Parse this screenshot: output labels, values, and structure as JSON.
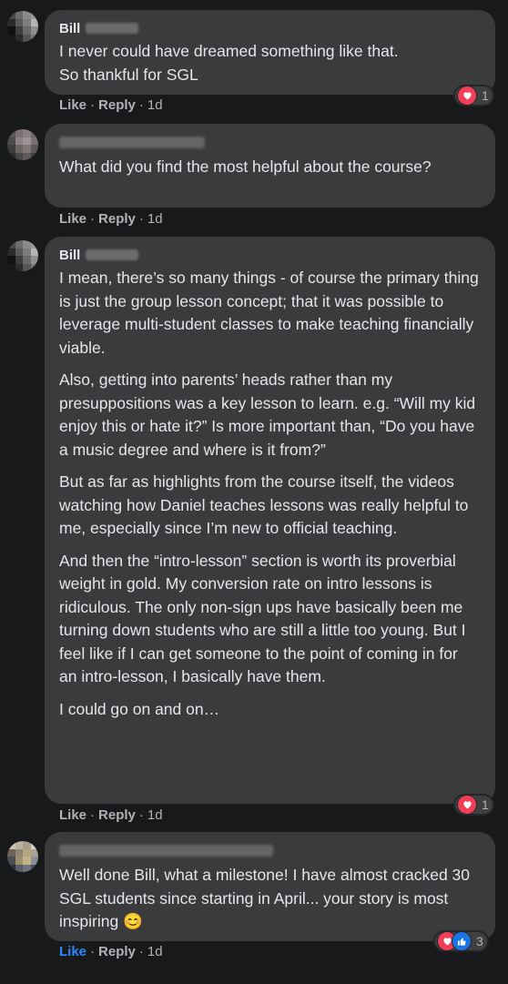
{
  "comments": [
    {
      "author_first": "Bill",
      "paragraphs": [
        "I never could have dreamed something like that.\nSo thankful for SGL"
      ],
      "actions": {
        "like": "Like",
        "reply": "Reply",
        "time": "1d"
      },
      "reactions": {
        "count": "1",
        "types": [
          "love-icon"
        ]
      }
    },
    {
      "author_first": "",
      "paragraphs": [
        "What did you find the most helpful about the course?"
      ],
      "actions": {
        "like": "Like",
        "reply": "Reply",
        "time": "1d"
      }
    },
    {
      "author_first": "Bill",
      "paragraphs": [
        "I mean, there’s so many things - of course the primary thing is just the group lesson concept; that it was possible to leverage multi-student classes to make teaching financially viable.",
        "Also, getting into parents’ heads rather than my presuppositions was a key lesson to learn. e.g. “Will my kid enjoy this or hate it?” Is more important than, “Do you have a music degree and where is it from?”",
        "But as far as highlights from the course itself, the videos watching how Daniel teaches lessons was really helpful to me, especially since I’m new to official teaching.",
        "And then the “intro-lesson” section is worth its proverbial weight in gold. My conversion rate on intro lessons is ridiculous. The only non-sign ups have basically been me turning down students who are still a little too young. But I feel like if I can get someone to the point of coming in for an intro-lesson, I basically have them.",
        "I could go on and on…"
      ],
      "actions": {
        "like": "Like",
        "reply": "Reply",
        "time": "1d"
      },
      "reactions": {
        "count": "1",
        "types": [
          "love-icon"
        ]
      }
    },
    {
      "author_first": "",
      "paragraphs": [
        "Well done Bill, what a milestone! I have almost cracked 30 SGL students since starting in April... your story is most inspiring 😊"
      ],
      "actions": {
        "like": "Like",
        "reply": "Reply",
        "time": "1d",
        "liked": true
      },
      "reactions": {
        "count": "3",
        "types": [
          "love-icon",
          "like-icon"
        ]
      }
    }
  ],
  "colors": {
    "background": "#18191a",
    "bubble": "#3a3b3c",
    "text": "#e4e6eb",
    "muted": "#b0b3b8",
    "like_active": "#2d88ff",
    "love": "#f33e58"
  }
}
